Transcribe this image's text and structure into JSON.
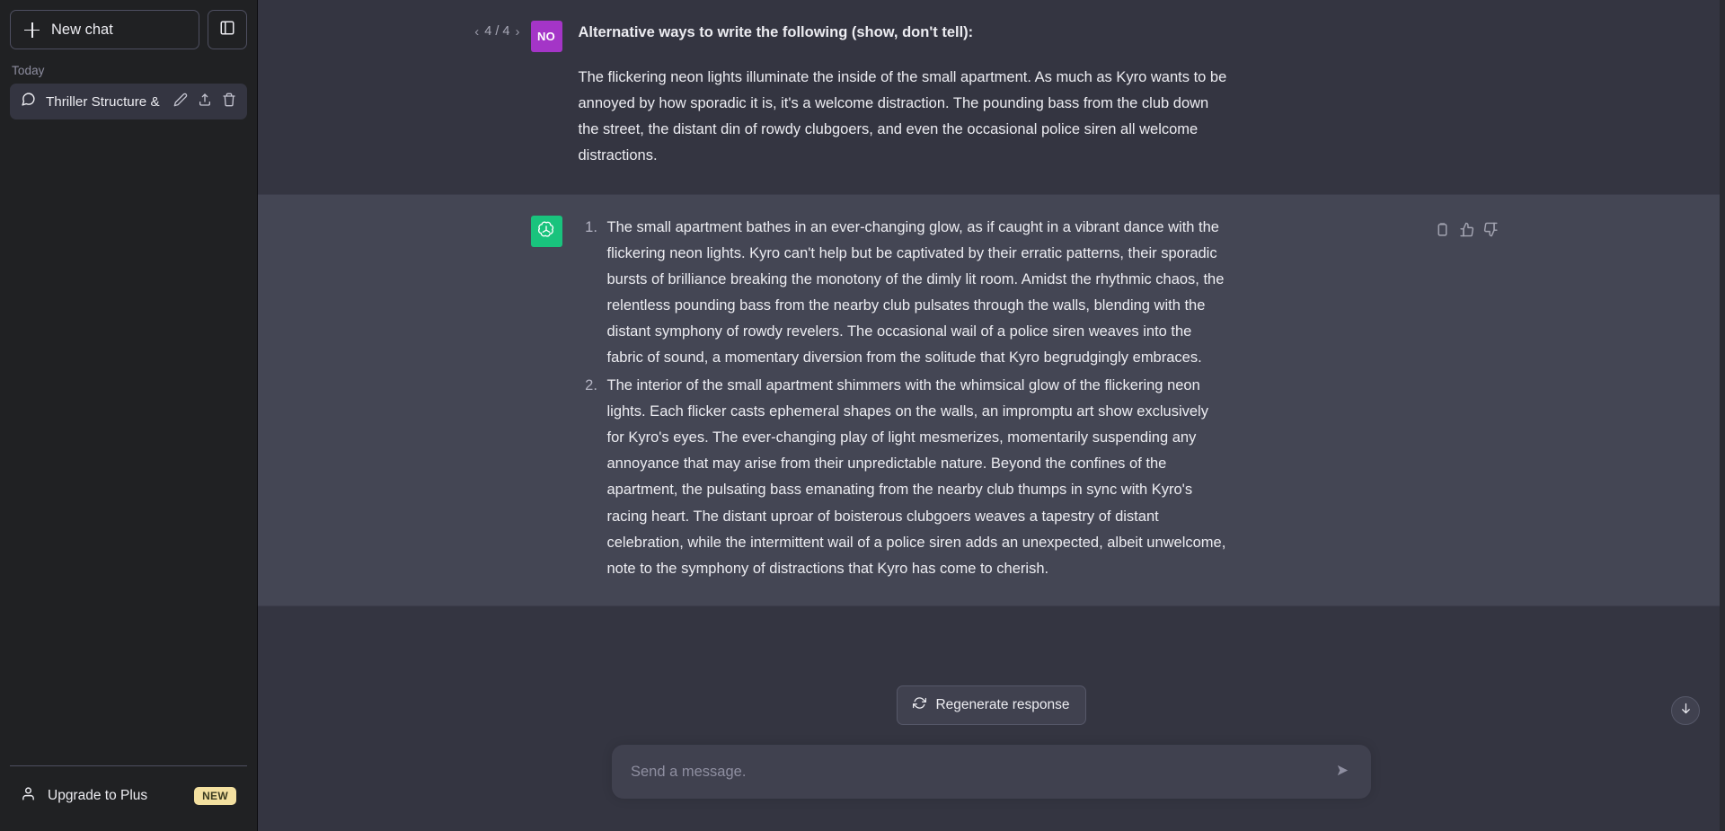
{
  "sidebar": {
    "new_chat_label": "New chat",
    "new_chat_icon": "plus-icon",
    "panel_toggle_icon": "sidebar-panel-toggle-icon",
    "section_label": "Today",
    "chats": [
      {
        "icon": "chat-bubble-icon",
        "title": "Thriller Structure & L",
        "actions": [
          "pencil-edit-icon",
          "share-upload-icon",
          "trash-delete-icon"
        ]
      }
    ],
    "upgrade": {
      "icon": "person-icon",
      "label": "Upgrade to Plus",
      "badge": "NEW",
      "badge_color": "#f3e0a0"
    }
  },
  "conversation": {
    "messages": [
      {
        "role": "user",
        "avatar_initials": "NO",
        "avatar_color": "#a435c7",
        "pagination": {
          "prev_icon": "chevron-left-icon",
          "next_icon": "chevron-right-icon",
          "label": "4 / 4"
        },
        "paragraphs": [
          "Alternative ways to write the following (show, don't tell):",
          "The flickering neon lights illuminate the inside of the small apartment. As much as Kyro wants to be annoyed by how sporadic it is, it's a welcome distraction. The pounding bass from the club down the street, the distant din of rowdy clubgoers, and even the occasional police siren all welcome distractions."
        ]
      },
      {
        "role": "assistant",
        "avatar_icon": "openai-logo-icon",
        "avatar_color": "#19c37d",
        "tools": [
          "copy-icon",
          "thumbs-up-icon",
          "thumbs-down-icon"
        ],
        "list_items": [
          "The small apartment bathes in an ever-changing glow, as if caught in a vibrant dance with the flickering neon lights. Kyro can't help but be captivated by their erratic patterns, their sporadic bursts of brilliance breaking the monotony of the dimly lit room. Amidst the rhythmic chaos, the relentless pounding bass from the nearby club pulsates through the walls, blending with the distant symphony of rowdy revelers. The occasional wail of a police siren weaves into the fabric of sound, a momentary diversion from the solitude that Kyro begrudgingly embraces.",
          "The interior of the small apartment shimmers with the whimsical glow of the flickering neon lights. Each flicker casts ephemeral shapes on the walls, an impromptu art show exclusively for Kyro's eyes. The ever-changing play of light mesmerizes, momentarily suspending any annoyance that may arise from their unpredictable nature. Beyond the confines of the apartment, the pulsating bass emanating from the nearby club thumps in sync with Kyro's racing heart. The distant uproar of boisterous clubgoers weaves a tapestry of distant celebration, while the intermittent wail of a police siren adds an unexpected, albeit unwelcome, note to the symphony of distractions that Kyro has come to cherish."
        ]
      }
    ]
  },
  "composer": {
    "regenerate_label": "Regenerate response",
    "regenerate_icon": "refresh-icon",
    "placeholder": "Send a message.",
    "value": "",
    "send_icon": "send-arrow-icon",
    "scroll_bottom_icon": "arrow-down-icon"
  }
}
